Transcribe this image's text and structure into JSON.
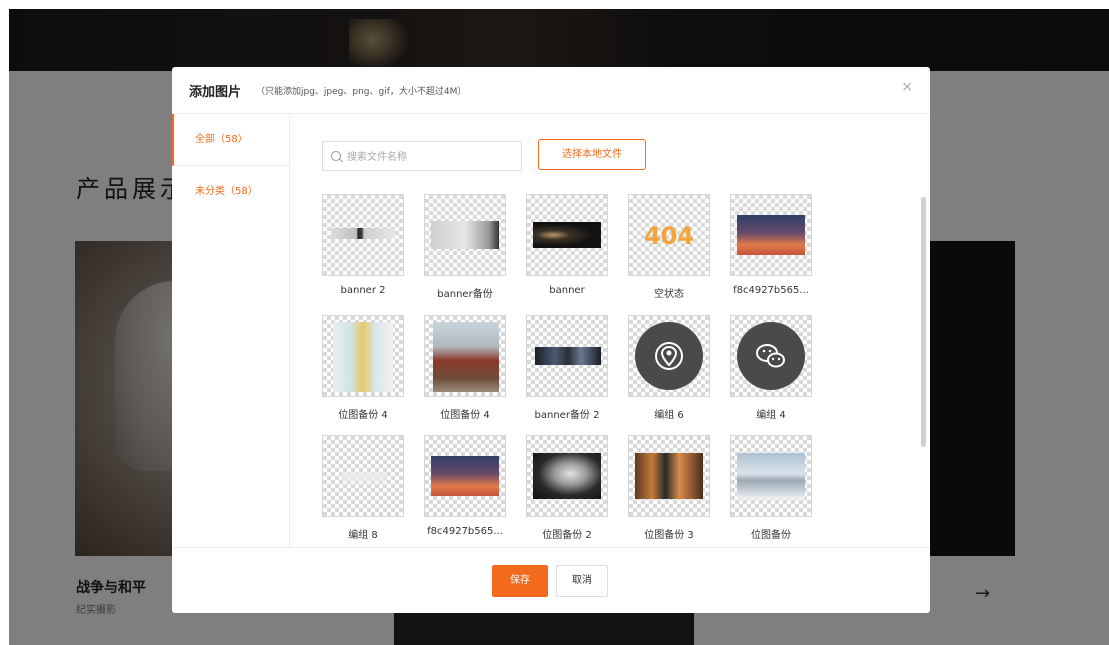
{
  "background": {
    "section_title": "产品展示",
    "card_caption": "战争与和平",
    "card_subcaption": "纪实摄影",
    "arrow": "→"
  },
  "modal": {
    "title": "添加图片",
    "hint": "（只能添加jpg、jpeg、png、gif，大小不超过4M）",
    "close": "×",
    "categories": [
      {
        "label": "全部（58）",
        "active": true
      },
      {
        "label": "未分类（58）",
        "active": false
      }
    ],
    "search": {
      "placeholder": "搜索文件名称",
      "value": ""
    },
    "local_button": "选择本地文件",
    "images": [
      {
        "label": "banner 2",
        "icon": "banner-thumbnail"
      },
      {
        "label": "banner备份",
        "icon": "banner-thumbnail"
      },
      {
        "label": "banner",
        "icon": "banner-thumbnail"
      },
      {
        "label": "空状态",
        "icon": "404-thumbnail"
      },
      {
        "label": "f8c4927b565...",
        "icon": "sunset-thumbnail"
      },
      {
        "label": "位图备份 4",
        "icon": "street-thumbnail"
      },
      {
        "label": "位图备份 4",
        "icon": "house-thumbnail"
      },
      {
        "label": "banner备份 2",
        "icon": "banner-thumbnail"
      },
      {
        "label": "编组 6",
        "icon": "location-pin-icon"
      },
      {
        "label": "编组 4",
        "icon": "wechat-icon"
      },
      {
        "label": "编组 8",
        "icon": "blank-thumbnail"
      },
      {
        "label": "f8c4927b565...",
        "icon": "sunset-thumbnail"
      },
      {
        "label": "位图备份 2",
        "icon": "statue-thumbnail"
      },
      {
        "label": "位图备份 3",
        "icon": "room-thumbnail"
      },
      {
        "label": "位图备份",
        "icon": "snow-thumbnail"
      }
    ],
    "save_button": "保存",
    "cancel_button": "取消"
  },
  "colors": {
    "accent": "#f26a1b",
    "overlay": "rgba(0,0,0,0.5)"
  }
}
